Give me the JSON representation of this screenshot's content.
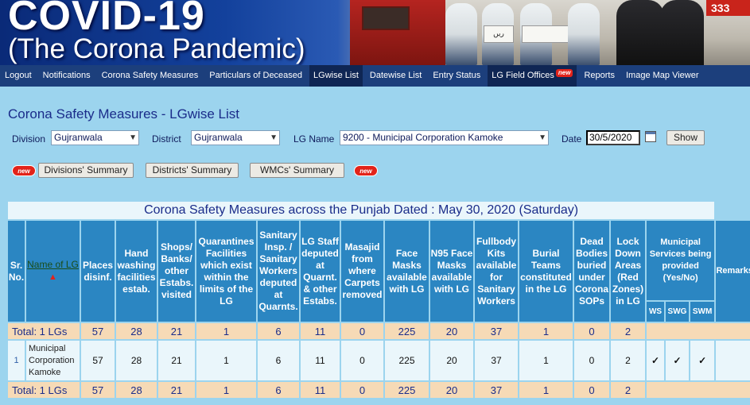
{
  "banner": {
    "title_line1": "COVID-19",
    "title_line2": "(The Corona Pandemic)",
    "sign_text": "ریں",
    "badge_number": "333"
  },
  "nav": [
    {
      "label": "Logout"
    },
    {
      "label": "Notifications"
    },
    {
      "label": "Corona Safety Measures"
    },
    {
      "label": "Particulars of Deceased"
    },
    {
      "label": "LGwise List",
      "active": true
    },
    {
      "label": "Datewise List"
    },
    {
      "label": "Entry Status"
    },
    {
      "label": "LG Field Offices",
      "badge": "new"
    },
    {
      "label": "Reports"
    },
    {
      "label": "Image Map Viewer"
    }
  ],
  "page_title": "Corona Safety Measures - LGwise List",
  "filters": {
    "division_label": "Division",
    "division_value": "Gujranwala",
    "district_label": "District",
    "district_value": "Gujranwala",
    "lg_label": "LG Name",
    "lg_value": "9200 - Municipal Corporation Kamoke",
    "date_label": "Date",
    "date_value": "30/5/2020",
    "show_button": "Show"
  },
  "summaries": {
    "new_badge": "new",
    "divisions": "Divisions' Summary",
    "districts": "Districts' Summary",
    "wmcs": "WMCs' Summary"
  },
  "table": {
    "caption": "Corona Safety Measures across the Punjab Dated : May 30, 2020 (Saturday)",
    "headers": {
      "sr": "Sr. No.",
      "name": "Name of LG",
      "sort": "▲",
      "places": "Places disinf.",
      "hand": "Hand washing facilities estab.",
      "shops": "Shops/ Banks/ other Estabs. visited",
      "quarantines": "Quarantines Facilities which exist within the limits of the LG",
      "sanitary": "Sanitary Insp. / Sanitary Workers deputed at Quarnts.",
      "lgstaff": "LG Staff deputed at Quarnt. & other Estabs.",
      "masajid": "Masajid from where Carpets removed",
      "face": "Face Masks available with LG",
      "n95": "N95 Face Masks available with LG",
      "fullbody": "Fullbody Kits available for Sanitary Workers",
      "burial": "Burial Teams constituted in the LG",
      "dead": "Dead Bodies buried under Corona SOPs",
      "lockdown": "Lock Down Areas (Red Zones) in LG",
      "municipal": "Municipal Services being provided (Yes/No)",
      "ws": "WS",
      "swg": "SWG",
      "swm": "SWM",
      "remarks": "Remarks"
    },
    "total_label": "Total: 1 LGs",
    "totals": [
      "57",
      "28",
      "21",
      "1",
      "6",
      "11",
      "0",
      "225",
      "20",
      "37",
      "1",
      "0",
      "2"
    ],
    "rows": [
      {
        "sr": "1",
        "name": "Municipal Corporation Kamoke",
        "values": [
          "57",
          "28",
          "21",
          "1",
          "6",
          "11",
          "0",
          "225",
          "20",
          "37",
          "1",
          "0",
          "2"
        ],
        "ws": "✓",
        "swg": "✓",
        "swm": "✓",
        "remarks": ""
      }
    ]
  }
}
